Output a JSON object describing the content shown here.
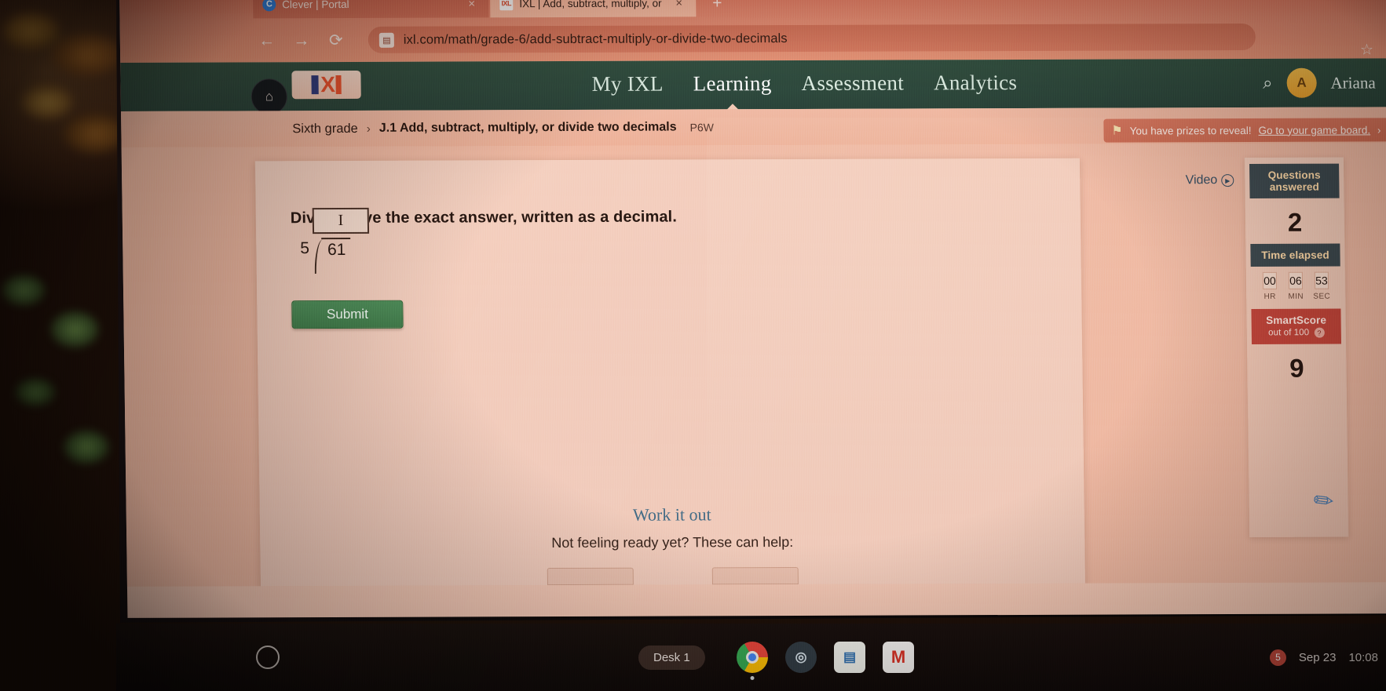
{
  "browser": {
    "tabs": [
      {
        "title": "Clever | Portal",
        "favicon": "clever-icon",
        "active": false
      },
      {
        "title": "IXL | Add, subtract, multiply, or",
        "favicon": "ixl-favicon",
        "active": true
      }
    ],
    "new_tab_label": "+",
    "close_label": "×",
    "back_icon": "←",
    "forward_icon": "→",
    "reload_icon": "⟳",
    "url": "ixl.com/math/grade-6/add-subtract-multiply-or-divide-two-decimals",
    "site_icon_glyph": "▤",
    "bookmark_star": "☆"
  },
  "ixl_nav": {
    "logo_x": "X",
    "items": [
      {
        "label": "My IXL",
        "active": false
      },
      {
        "label": "Learning",
        "active": true
      },
      {
        "label": "Assessment",
        "active": false
      },
      {
        "label": "Analytics",
        "active": false
      }
    ],
    "search_glyph": "⌕",
    "user_name": "Ariana",
    "avatar_initial": "A",
    "school_glyph": "⌂"
  },
  "breadcrumb": {
    "grade": "Sixth grade",
    "separator": "›",
    "skill": "J.1 Add, subtract, multiply, or divide two decimals",
    "skill_code": "P6W"
  },
  "prize_banner": {
    "trophy_glyph": "Ἴ6",
    "text": "You have prizes to reveal!",
    "link_text": "Go to your game board.",
    "chevron": "›"
  },
  "question": {
    "prompt": "Divide. Give the exact answer, written as a decimal.",
    "divisor": "5",
    "dividend": "61",
    "answer_value": "",
    "caret_glyph": "I",
    "submit_label": "Submit"
  },
  "help_section": {
    "heading": "Work it out",
    "prompt": "Not feeling ready yet? These can help:"
  },
  "side_panel": {
    "video_label": "Video",
    "video_icon_glyph": "▶",
    "questions_answered_label": "Questions answered",
    "questions_answered_value": "2",
    "time_elapsed_label": "Time elapsed",
    "timer": [
      {
        "value": "00",
        "unit": "HR"
      },
      {
        "value": "06",
        "unit": "MIN"
      },
      {
        "value": "53",
        "unit": "SEC"
      }
    ],
    "smartscore_label": "SmartScore",
    "smartscore_sub": "out of 100",
    "smartscore_help_glyph": "?",
    "smartscore_value": "9",
    "pencil_glyph": "✎"
  },
  "shelf": {
    "desk_label": "Desk 1",
    "apps": [
      {
        "name": "chrome-app-icon",
        "label": ""
      },
      {
        "name": "camera-app-icon",
        "label": "◎"
      },
      {
        "name": "slides-app-icon",
        "label": "▤"
      },
      {
        "name": "gmail-app-icon",
        "label": "M"
      }
    ],
    "notification_count": "5",
    "date": "Sep 23",
    "time": "10:08"
  },
  "colors": {
    "ixl_green": "#2f4f41",
    "submit_green": "#4a8c5a",
    "smartscore_red": "#c2453b",
    "panel_dark": "#39484f",
    "work_it_out_blue": "#3e6a86"
  }
}
